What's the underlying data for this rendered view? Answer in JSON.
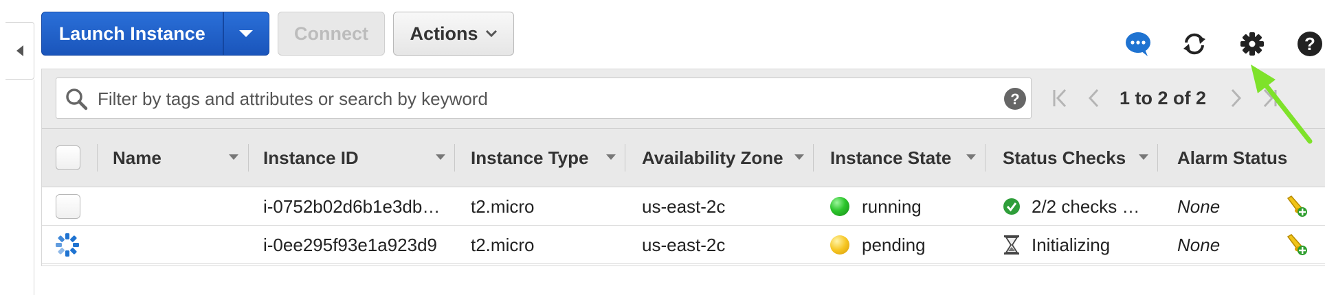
{
  "toolbar": {
    "launch_label": "Launch Instance",
    "connect_label": "Connect",
    "actions_label": "Actions"
  },
  "top_icons": [
    "chat-icon",
    "refresh-icon",
    "settings-gear-icon",
    "help-icon"
  ],
  "search": {
    "placeholder": "Filter by tags and attributes or search by keyword",
    "value": ""
  },
  "pagination": {
    "range_text": "1 to 2 of 2"
  },
  "table": {
    "columns": [
      "Name",
      "Instance ID",
      "Instance Type",
      "Availability Zone",
      "Instance State",
      "Status Checks",
      "Alarm Status"
    ],
    "rows": [
      {
        "name": "",
        "instance_id": "i-0752b02d6b1e3db…",
        "instance_type": "t2.micro",
        "availability_zone": "us-east-2c",
        "instance_state": "running",
        "status_checks": "2/2 checks …",
        "alarm_status": "None"
      },
      {
        "name": "",
        "instance_id": "i-0ee295f93e1a923d9",
        "instance_type": "t2.micro",
        "availability_zone": "us-east-2c",
        "instance_state": "pending",
        "status_checks": "Initializing",
        "alarm_status": "None"
      }
    ]
  },
  "colors": {
    "primary_button": "#1a55bb",
    "running": "#2cc52c",
    "pending": "#f6c623",
    "annotation_arrow": "#7ee22a"
  }
}
